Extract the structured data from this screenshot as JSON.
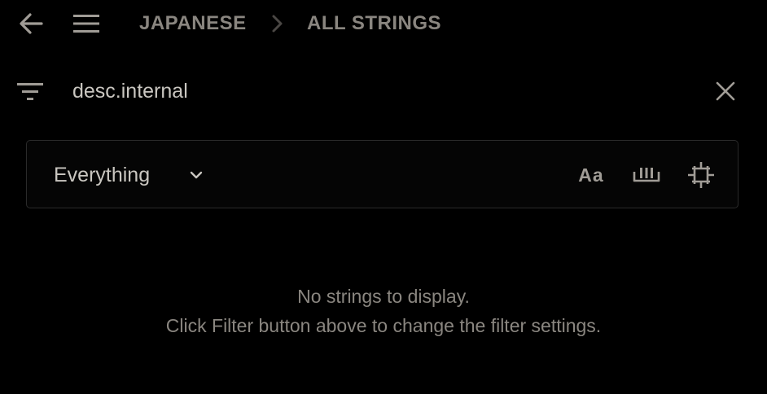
{
  "header": {
    "back_icon": "arrow-left-icon",
    "menu_icon": "hamburger-menu-icon",
    "breadcrumb": {
      "items": [
        "JAPANESE",
        "ALL STRINGS"
      ],
      "separator_icon": "chevron-right-icon"
    }
  },
  "filter": {
    "icon": "filter-icon",
    "query": "desc.internal",
    "clear_icon": "close-icon"
  },
  "options": {
    "scope": {
      "selected": "Everything",
      "chevron_icon": "chevron-down-icon"
    },
    "match_case": {
      "label": "Aa",
      "icon": "match-case-icon"
    },
    "whole_word_icon": "whole-word-icon",
    "regex_icon": "selection-frame-icon"
  },
  "empty_state": {
    "line1": "No strings to display.",
    "line2": "Click Filter button above to change the filter settings."
  },
  "colors": {
    "background": "#000000",
    "text_primary": "#c9c6c0",
    "text_muted": "#8a8680",
    "panel_border": "#2a2a2a"
  }
}
